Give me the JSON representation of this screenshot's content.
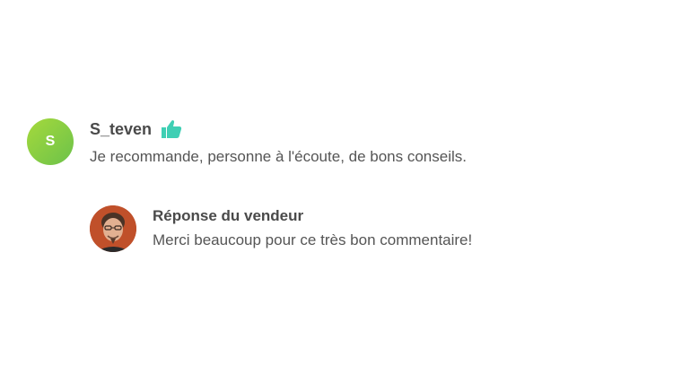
{
  "review": {
    "avatar_letter": "S",
    "username": "S_teven",
    "rating_icon": "thumbs-up-icon",
    "text": "Je recommande, personne à l'écoute, de bons conseils."
  },
  "reply": {
    "avatar_icon": "seller-photo",
    "title": "Réponse du vendeur",
    "text": "Merci beaucoup pour ce très bon commentaire!"
  },
  "colors": {
    "avatar_gradient_start": "#a5d93c",
    "avatar_gradient_end": "#6cc24a",
    "thumb": "#3fcfb4",
    "text": "#4a4a4a"
  }
}
